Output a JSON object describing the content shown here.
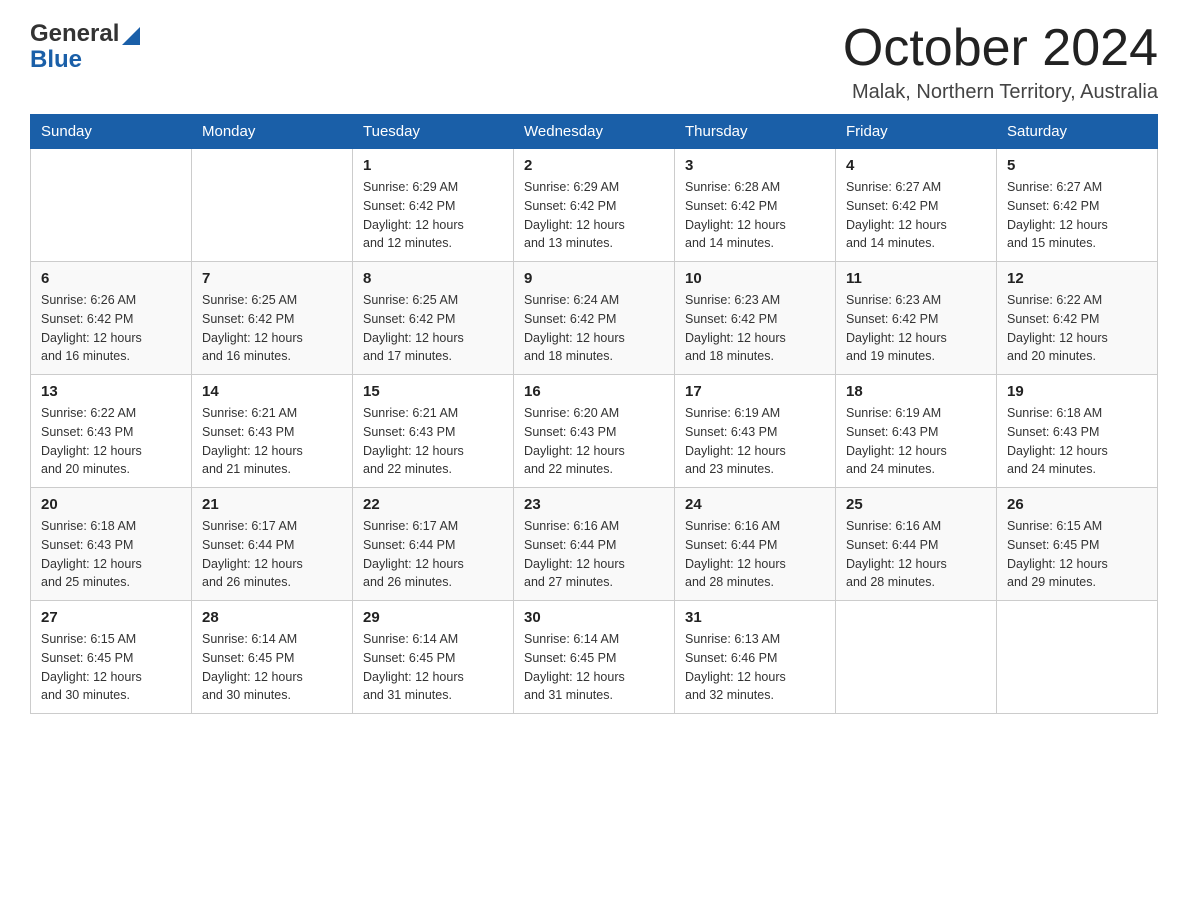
{
  "logo": {
    "general": "General",
    "blue": "Blue"
  },
  "header": {
    "month": "October 2024",
    "location": "Malak, Northern Territory, Australia"
  },
  "weekdays": [
    "Sunday",
    "Monday",
    "Tuesday",
    "Wednesday",
    "Thursday",
    "Friday",
    "Saturday"
  ],
  "weeks": [
    [
      {
        "day": "",
        "info": ""
      },
      {
        "day": "",
        "info": ""
      },
      {
        "day": "1",
        "info": "Sunrise: 6:29 AM\nSunset: 6:42 PM\nDaylight: 12 hours\nand 12 minutes."
      },
      {
        "day": "2",
        "info": "Sunrise: 6:29 AM\nSunset: 6:42 PM\nDaylight: 12 hours\nand 13 minutes."
      },
      {
        "day": "3",
        "info": "Sunrise: 6:28 AM\nSunset: 6:42 PM\nDaylight: 12 hours\nand 14 minutes."
      },
      {
        "day": "4",
        "info": "Sunrise: 6:27 AM\nSunset: 6:42 PM\nDaylight: 12 hours\nand 14 minutes."
      },
      {
        "day": "5",
        "info": "Sunrise: 6:27 AM\nSunset: 6:42 PM\nDaylight: 12 hours\nand 15 minutes."
      }
    ],
    [
      {
        "day": "6",
        "info": "Sunrise: 6:26 AM\nSunset: 6:42 PM\nDaylight: 12 hours\nand 16 minutes."
      },
      {
        "day": "7",
        "info": "Sunrise: 6:25 AM\nSunset: 6:42 PM\nDaylight: 12 hours\nand 16 minutes."
      },
      {
        "day": "8",
        "info": "Sunrise: 6:25 AM\nSunset: 6:42 PM\nDaylight: 12 hours\nand 17 minutes."
      },
      {
        "day": "9",
        "info": "Sunrise: 6:24 AM\nSunset: 6:42 PM\nDaylight: 12 hours\nand 18 minutes."
      },
      {
        "day": "10",
        "info": "Sunrise: 6:23 AM\nSunset: 6:42 PM\nDaylight: 12 hours\nand 18 minutes."
      },
      {
        "day": "11",
        "info": "Sunrise: 6:23 AM\nSunset: 6:42 PM\nDaylight: 12 hours\nand 19 minutes."
      },
      {
        "day": "12",
        "info": "Sunrise: 6:22 AM\nSunset: 6:42 PM\nDaylight: 12 hours\nand 20 minutes."
      }
    ],
    [
      {
        "day": "13",
        "info": "Sunrise: 6:22 AM\nSunset: 6:43 PM\nDaylight: 12 hours\nand 20 minutes."
      },
      {
        "day": "14",
        "info": "Sunrise: 6:21 AM\nSunset: 6:43 PM\nDaylight: 12 hours\nand 21 minutes."
      },
      {
        "day": "15",
        "info": "Sunrise: 6:21 AM\nSunset: 6:43 PM\nDaylight: 12 hours\nand 22 minutes."
      },
      {
        "day": "16",
        "info": "Sunrise: 6:20 AM\nSunset: 6:43 PM\nDaylight: 12 hours\nand 22 minutes."
      },
      {
        "day": "17",
        "info": "Sunrise: 6:19 AM\nSunset: 6:43 PM\nDaylight: 12 hours\nand 23 minutes."
      },
      {
        "day": "18",
        "info": "Sunrise: 6:19 AM\nSunset: 6:43 PM\nDaylight: 12 hours\nand 24 minutes."
      },
      {
        "day": "19",
        "info": "Sunrise: 6:18 AM\nSunset: 6:43 PM\nDaylight: 12 hours\nand 24 minutes."
      }
    ],
    [
      {
        "day": "20",
        "info": "Sunrise: 6:18 AM\nSunset: 6:43 PM\nDaylight: 12 hours\nand 25 minutes."
      },
      {
        "day": "21",
        "info": "Sunrise: 6:17 AM\nSunset: 6:44 PM\nDaylight: 12 hours\nand 26 minutes."
      },
      {
        "day": "22",
        "info": "Sunrise: 6:17 AM\nSunset: 6:44 PM\nDaylight: 12 hours\nand 26 minutes."
      },
      {
        "day": "23",
        "info": "Sunrise: 6:16 AM\nSunset: 6:44 PM\nDaylight: 12 hours\nand 27 minutes."
      },
      {
        "day": "24",
        "info": "Sunrise: 6:16 AM\nSunset: 6:44 PM\nDaylight: 12 hours\nand 28 minutes."
      },
      {
        "day": "25",
        "info": "Sunrise: 6:16 AM\nSunset: 6:44 PM\nDaylight: 12 hours\nand 28 minutes."
      },
      {
        "day": "26",
        "info": "Sunrise: 6:15 AM\nSunset: 6:45 PM\nDaylight: 12 hours\nand 29 minutes."
      }
    ],
    [
      {
        "day": "27",
        "info": "Sunrise: 6:15 AM\nSunset: 6:45 PM\nDaylight: 12 hours\nand 30 minutes."
      },
      {
        "day": "28",
        "info": "Sunrise: 6:14 AM\nSunset: 6:45 PM\nDaylight: 12 hours\nand 30 minutes."
      },
      {
        "day": "29",
        "info": "Sunrise: 6:14 AM\nSunset: 6:45 PM\nDaylight: 12 hours\nand 31 minutes."
      },
      {
        "day": "30",
        "info": "Sunrise: 6:14 AM\nSunset: 6:45 PM\nDaylight: 12 hours\nand 31 minutes."
      },
      {
        "day": "31",
        "info": "Sunrise: 6:13 AM\nSunset: 6:46 PM\nDaylight: 12 hours\nand 32 minutes."
      },
      {
        "day": "",
        "info": ""
      },
      {
        "day": "",
        "info": ""
      }
    ]
  ]
}
